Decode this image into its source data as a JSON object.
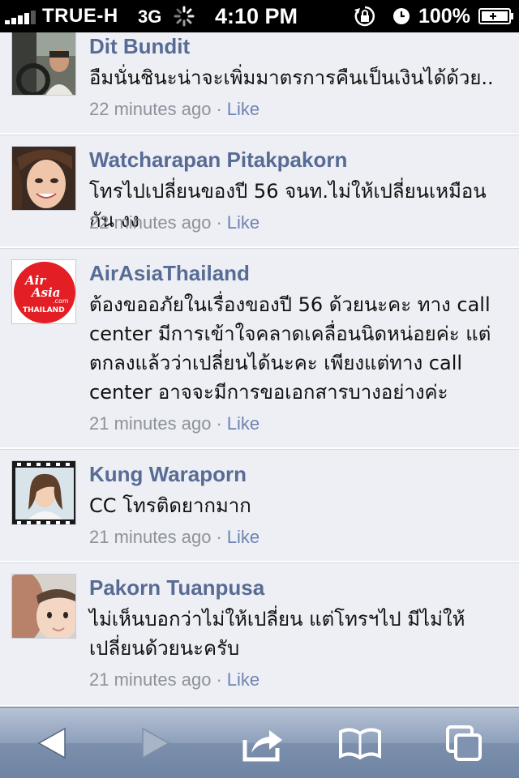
{
  "status_bar": {
    "carrier": "TRUE-H",
    "network": "3G",
    "time": "4:10 PM",
    "battery_percent": "100%",
    "signal_bars": 4
  },
  "comments": [
    {
      "name": "Dit Bundit",
      "text": "อืมนั่นชินะน่าจะเพิ่มมาตรการคืนเป็นเงินได้ด้วย..",
      "time": "22 minutes ago",
      "separator": "·",
      "like_label": "Like",
      "avatar": "man-in-car-avatar"
    },
    {
      "name": "Watcharapan Pitakpakorn",
      "text": "โทรไปเปลี่ยนของปี 56 จนท.ไม่ให้เปลี่ยนเหมือนกัน งง",
      "time": "22 minutes ago",
      "separator": "·",
      "like_label": "Like",
      "avatar": "woman-smiling-avatar"
    },
    {
      "name": "AirAsiaThailand",
      "text": "ต้องขออภัยในเรื่องของปี 56 ด้วยนะคะ ทาง call center มีการเข้าใจคลาดเคลื่อนนิดหน่อยค่ะ แต่ตกลงแล้วว่าเปลี่ยนได้นะคะ เพียงแต่ทาง call center อาจจะมีการขอเอกสารบางอย่างค่ะ",
      "time": "21 minutes ago",
      "separator": "·",
      "like_label": "Like",
      "avatar": "airasia-logo",
      "logo_text": [
        "Air",
        "Asia",
        ".com",
        "THAILAND"
      ]
    },
    {
      "name": "Kung Waraporn",
      "text": "CC โทรติดยากมาก",
      "time": "21 minutes ago",
      "separator": "·",
      "like_label": "Like",
      "avatar": "woman-film-frame-avatar"
    },
    {
      "name": "Pakorn Tuanpusa",
      "text": "ไม่เห็นบอกว่าไม่ให้เปลี่ยน แต่โทรฯไป มีไม่ให้เปลี่ยนด้วยนะครับ",
      "time": "21 minutes ago",
      "separator": "·",
      "like_label": "Like",
      "avatar": "man-and-child-avatar"
    }
  ],
  "toolbar": {
    "buttons": [
      "back-arrow-icon",
      "forward-arrow-icon",
      "share-icon",
      "bookmarks-icon",
      "tabs-icon"
    ]
  },
  "colors": {
    "name": "#576b95",
    "like": "#6d84b4",
    "meta": "#8c919b",
    "row_bg": "#edeff4",
    "airasia_red": "#e31e24"
  }
}
